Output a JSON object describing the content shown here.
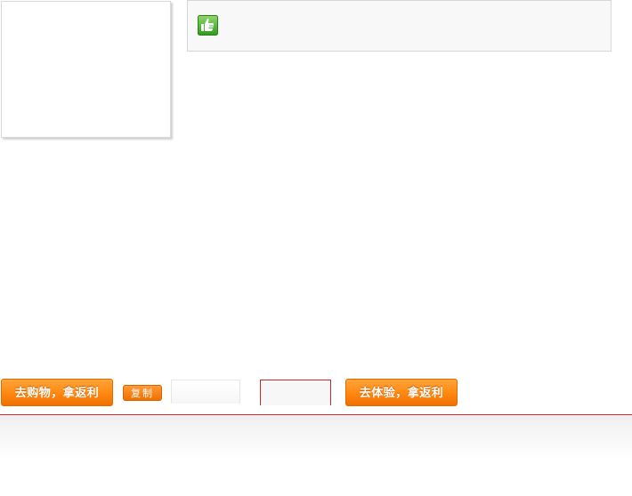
{
  "icons": {
    "recommend": "thumbs-up-icon"
  },
  "buttons": {
    "shop_label": "去购物，拿返利",
    "copy_label": "复制",
    "experience_label": "去体验，拿返利"
  },
  "fields": {
    "first_value": "",
    "second_value": ""
  },
  "colors": {
    "accent_orange": "#ff8a12",
    "divider_red": "#d42f2f",
    "icon_green": "#4caf2a"
  }
}
